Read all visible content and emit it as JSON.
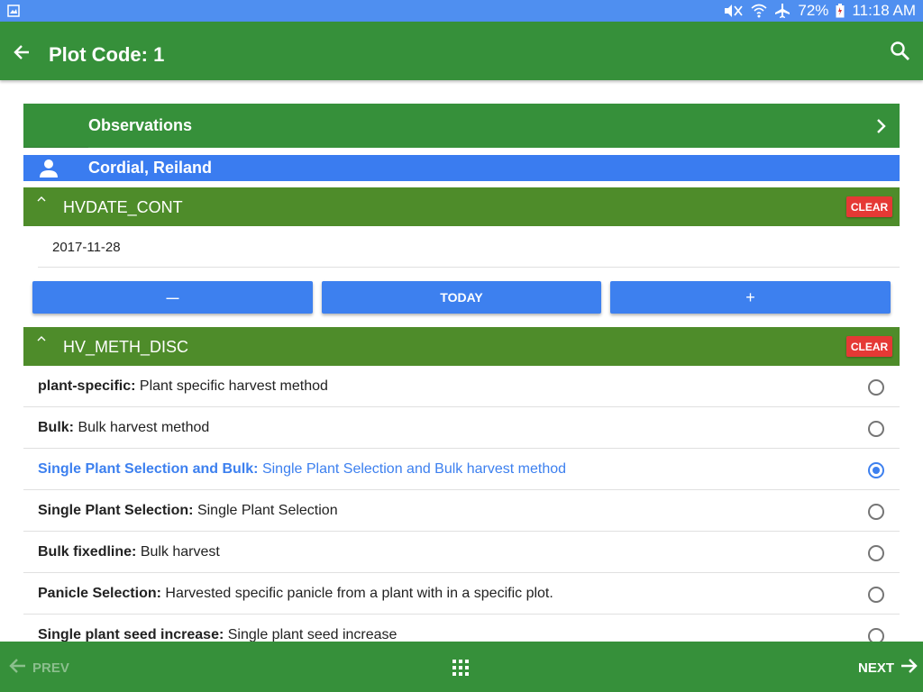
{
  "status_bar": {
    "battery": "72%",
    "time": "11:18 AM"
  },
  "app_bar": {
    "title": "Plot Code: 1"
  },
  "observations": {
    "label": "Observations"
  },
  "person": {
    "name": "Cordial, Reiland"
  },
  "hvdate": {
    "name": "HVDATE_CONT",
    "clear_label": "CLEAR",
    "value": "2017-11-28",
    "minus_label": "—",
    "today_label": "TODAY",
    "plus_label": "+"
  },
  "hvmeth": {
    "name": "HV_METH_DISC",
    "clear_label": "CLEAR",
    "options": [
      {
        "key": "plant-specific:",
        "desc": "Plant specific harvest method",
        "selected": false
      },
      {
        "key": "Bulk:",
        "desc": "Bulk harvest method",
        "selected": false
      },
      {
        "key": "Single Plant Selection and Bulk:",
        "desc": "Single Plant Selection and Bulk harvest method",
        "selected": true
      },
      {
        "key": "Single Plant Selection:",
        "desc": "Single Plant Selection",
        "selected": false
      },
      {
        "key": "Bulk fixedline:",
        "desc": "Bulk harvest",
        "selected": false
      },
      {
        "key": "Panicle Selection:",
        "desc": "Harvested specific panicle from a plant with in a specific plot.",
        "selected": false
      },
      {
        "key": "Single plant seed increase:",
        "desc": "Single plant seed increase",
        "selected": false
      }
    ]
  },
  "bottom_bar": {
    "prev_label": "PREV",
    "next_label": "NEXT"
  },
  "colors": {
    "green": "#36903a",
    "section_green": "#4e8c2a",
    "blue": "#3d80ef",
    "red": "#e53935"
  }
}
